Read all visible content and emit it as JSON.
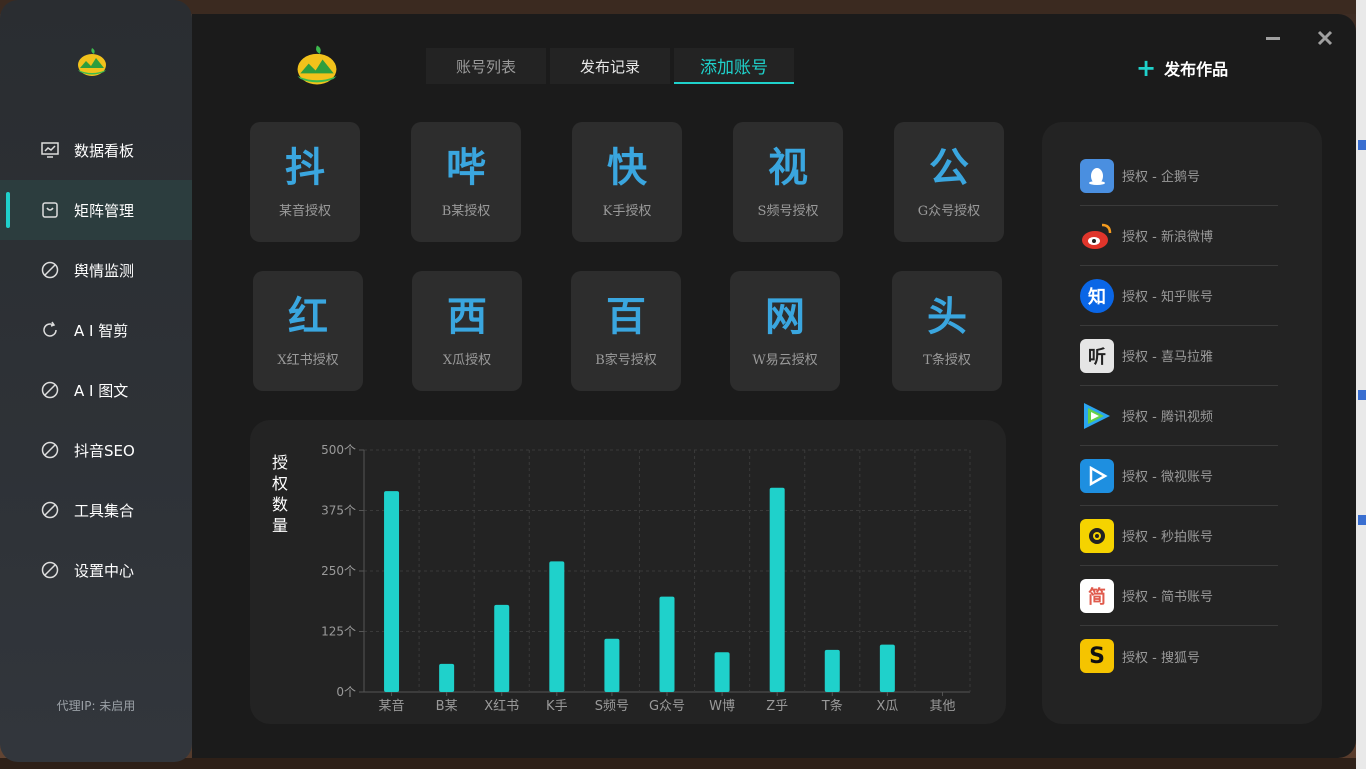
{
  "sidebar": {
    "items": [
      {
        "label": "数据看板",
        "icon": "monitor-chart-icon"
      },
      {
        "label": "矩阵管理",
        "icon": "bag-icon",
        "active": true
      },
      {
        "label": "舆情监测",
        "icon": "slash-circle-icon"
      },
      {
        "label": "A I 智剪",
        "icon": "refresh-icon"
      },
      {
        "label": "A I 图文",
        "icon": "slash-circle-icon"
      },
      {
        "label": "抖音SEO",
        "icon": "slash-circle-icon"
      },
      {
        "label": "工具集合",
        "icon": "slash-circle-icon"
      },
      {
        "label": "设置中心",
        "icon": "slash-circle-icon"
      }
    ],
    "proxy": "代理IP: 未启用"
  },
  "header": {
    "tabs": [
      {
        "label": "账号列表"
      },
      {
        "label": "发布记录"
      },
      {
        "label": "添加账号",
        "active": true
      }
    ],
    "publish": "发布作品",
    "publish_icon": "+"
  },
  "platforms": [
    {
      "glyph": "抖",
      "label": "某音授权"
    },
    {
      "glyph": "哔",
      "label": "B某授权"
    },
    {
      "glyph": "快",
      "label": "K手授权"
    },
    {
      "glyph": "视",
      "label": "S频号授权"
    },
    {
      "glyph": "公",
      "label": "G众号授权"
    },
    {
      "glyph": "红",
      "label": "X红书授权"
    },
    {
      "glyph": "西",
      "label": "X瓜授权"
    },
    {
      "glyph": "百",
      "label": "B家号授权"
    },
    {
      "glyph": "网",
      "label": "W易云授权"
    },
    {
      "glyph": "头",
      "label": "T条授权"
    }
  ],
  "auth_list": [
    {
      "label": "授权 - 企鹅号",
      "icon": "penguin-icon",
      "color": "#4a8fe0"
    },
    {
      "label": "授权 - 新浪微博",
      "icon": "weibo-icon",
      "color": "#e0352b"
    },
    {
      "label": "授权 - 知乎账号",
      "icon": "zhihu-icon",
      "color": "#0a66e6",
      "glyph": "知"
    },
    {
      "label": "授权 - 喜马拉雅",
      "icon": "ximalaya-icon",
      "color": "#e5e5e5",
      "glyph": "听"
    },
    {
      "label": "授权 - 腾讯视频",
      "icon": "tencent-video-icon",
      "color": "#2aa5f0"
    },
    {
      "label": "授权 - 微视账号",
      "icon": "weishi-icon",
      "color": "#1e8fe0"
    },
    {
      "label": "授权 - 秒拍账号",
      "icon": "miaopai-icon",
      "color": "#f5d300"
    },
    {
      "label": "授权 - 简书账号",
      "icon": "jianshu-icon",
      "color": "#ffffff",
      "glyph": "简"
    },
    {
      "label": "授权 - 搜狐号",
      "icon": "sohu-icon",
      "color": "#f5c400",
      "glyph": "S"
    }
  ],
  "chart_data": {
    "type": "bar",
    "ylabel": "授权数量",
    "categories": [
      "某音",
      "B某",
      "X红书",
      "K手",
      "S频号",
      "G众号",
      "W博",
      "Z乎",
      "T条",
      "X瓜",
      "其他"
    ],
    "values": [
      415,
      58,
      180,
      270,
      110,
      197,
      82,
      422,
      87,
      98,
      0
    ],
    "ylim": [
      0,
      500
    ],
    "yticks": [
      "0个",
      "125个",
      "250个",
      "375个",
      "500个"
    ],
    "ytick_values": [
      0,
      125,
      250,
      375,
      500
    ],
    "grid": true,
    "bar_color": "#1fd1cb"
  }
}
